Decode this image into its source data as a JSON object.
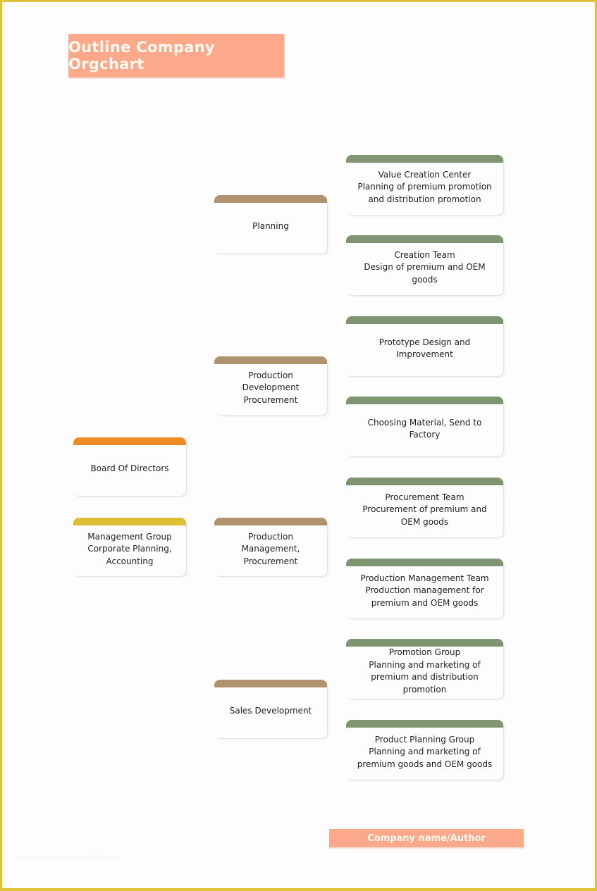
{
  "title": "Outline Company Orgchart",
  "footer": "Company name/Author",
  "watermark": "ssuuwwmmaaacaaccountingslocom",
  "colors": {
    "frame": "#e0c23a",
    "banner": "#fca88a",
    "board_bar": "#f08a25",
    "management_bar": "#dcbf32",
    "department_bar": "#b0936e",
    "team_bar": "#7f9470"
  },
  "left_column": [
    {
      "id": "board",
      "text": "Board Of Directors"
    },
    {
      "id": "management",
      "text": "Management Group\nCorporate Planning,\nAccounting"
    }
  ],
  "departments": [
    {
      "id": "planning",
      "text": "Planning"
    },
    {
      "id": "production-dev",
      "text": "Production\nDevelopment\nProcurement"
    },
    {
      "id": "production-mgmt",
      "text": "Production\nManagement,\nProcurement"
    },
    {
      "id": "sales",
      "text": "Sales Development"
    }
  ],
  "teams": [
    {
      "id": "value-creation",
      "text": "Value Creation Center\nPlanning of premium promotion\nand distribution promotion"
    },
    {
      "id": "creation-team",
      "text": "Creation Team\nDesign of premium and OEM\ngoods"
    },
    {
      "id": "prototype",
      "text": "Prototype Design and\nImprovement"
    },
    {
      "id": "choosing-material",
      "text": "Choosing Material, Send to\nFactory"
    },
    {
      "id": "procurement-team",
      "text": "Procurement Team\nProcurement of premium and\nOEM goods"
    },
    {
      "id": "production-mgmt-team",
      "text": "Production Management Team\nProduction management for\npremium and OEM goods"
    },
    {
      "id": "promotion-group",
      "text": "Promotion Group\nPlanning and marketing of\npremium and distribution\npromotion"
    },
    {
      "id": "product-planning",
      "text": "Product Planning Group\nPlanning and marketing of\npremium goods and OEM goods"
    }
  ]
}
